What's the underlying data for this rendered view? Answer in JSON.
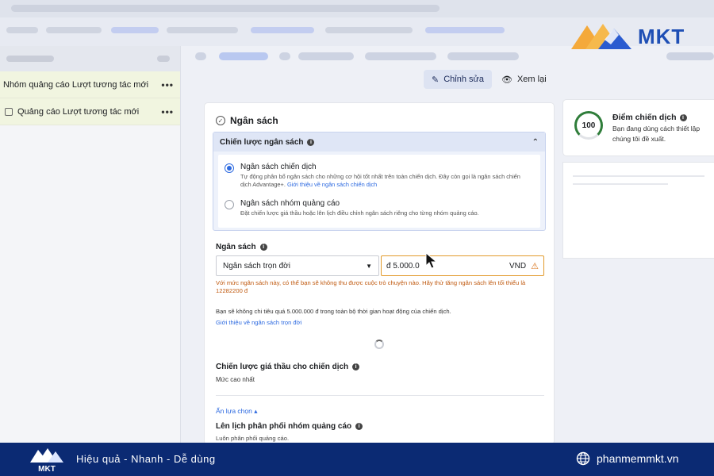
{
  "brand": {
    "logo_text": "MKT",
    "mini_logo_text": "MKT",
    "tagline": "Hiệu quả - Nhanh - Dễ dùng",
    "website": "phanmemmkt.vn",
    "accent_color": "#1f4fb5",
    "footer_color": "#0b2a73"
  },
  "sidebar": {
    "items": [
      {
        "label": "Nhóm quảng cáo Lượt tương tác mới",
        "more": "•••"
      },
      {
        "label": "Quảng cáo Lượt tương tác mới",
        "more": "•••"
      }
    ]
  },
  "toolbar": {
    "edit_label": "Chỉnh sửa",
    "review_label": "Xem lại"
  },
  "budget_section": {
    "title": "Ngân sách",
    "strategy_header": "Chiến lược ngân sách",
    "options": [
      {
        "title": "Ngân sách chiến dịch",
        "desc": "Tự động phân bổ ngân sách cho những cơ hội tốt nhất trên toàn chiến dịch. Đây còn gọi là ngân sách chiến dịch Advantage+.",
        "link": "Giới thiệu về ngân sách chiến dịch",
        "selected": true
      },
      {
        "title": "Ngân sách nhóm quảng cáo",
        "desc": "Đặt chiến lược giá thầu hoặc lên lịch điều chỉnh ngân sách riêng cho từng nhóm quảng cáo.",
        "selected": false
      }
    ],
    "budget_label": "Ngân sách",
    "budget_type": "Ngân sách trọn đời",
    "amount_value": "đ 5.000.0",
    "currency": "VND",
    "warning": "Với mức ngân sách này, có thể bạn sẽ không thu được cuộc trò chuyện nào. Hãy thử tăng ngân sách lên tối thiểu là 12282200 đ",
    "spend_note": "Bạn sẽ không chi tiêu quá 5.000.000 đ trong toàn bộ thời gian hoạt động của chiến dịch.",
    "spend_link": "Giới thiệu về ngân sách trọn đời",
    "bid_strategy_title": "Chiến lược giá thầu cho chiến dịch",
    "bid_strategy_value": "Mức cao nhất",
    "hide_options": "Ẩn lựa chọn ▴",
    "schedule_title": "Lên lịch phân phối nhóm quảng cáo",
    "schedule_value": "Luôn phân phối quảng cáo."
  },
  "score_panel": {
    "score": "100",
    "title": "Điểm chiến dịch",
    "desc": "Bạn đang dùng cách thiết lập chúng tôi đề xuất.",
    "gauge_color": "#2f7d3a"
  }
}
